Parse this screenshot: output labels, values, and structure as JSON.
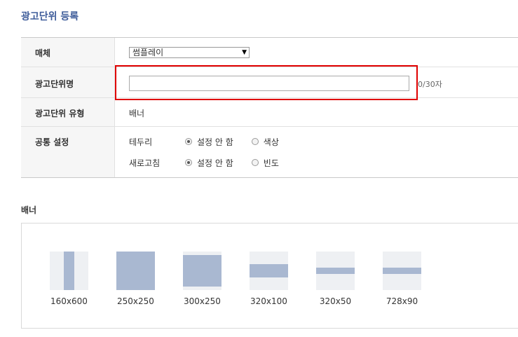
{
  "page_title": "광고단위 등록",
  "form": {
    "media_label": "매체",
    "media_value": "썸플레이",
    "media_arrow": "▼",
    "name_label": "광고단위명",
    "name_value": "",
    "name_count": "0/30자",
    "type_label": "광고단위 유형",
    "type_value": "배너",
    "common_label": "공통 설정",
    "border_label": "테두리",
    "border_options": [
      "설정 안 함",
      "색상"
    ],
    "refresh_label": "새로고침",
    "refresh_options": [
      "설정 안 함",
      "빈도"
    ]
  },
  "banner_section": {
    "title": "배너",
    "sizes": [
      "160x600",
      "250x250",
      "300x250",
      "320x100",
      "320x50",
      "728x90"
    ]
  },
  "colors": {
    "title": "#3e5c9a",
    "highlight": "#e00000",
    "thumb_fill": "#a9b8d1",
    "thumb_bg": "#eef0f3"
  }
}
